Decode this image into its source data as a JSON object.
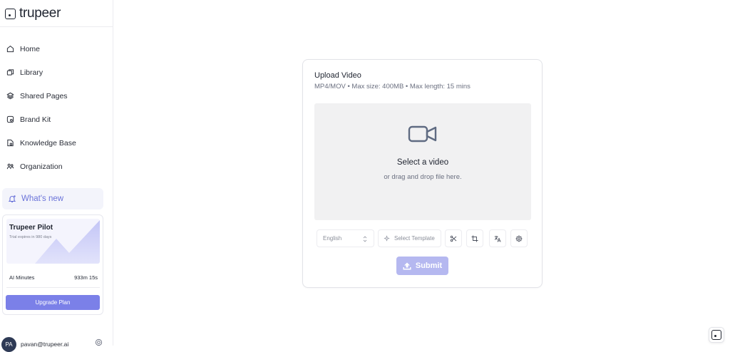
{
  "brand": {
    "name": "trupeer"
  },
  "sidebar": {
    "items": [
      {
        "label": "Home",
        "icon": "home-icon"
      },
      {
        "label": "Library",
        "icon": "library-icon"
      },
      {
        "label": "Shared Pages",
        "icon": "layers-icon"
      },
      {
        "label": "Brand Kit",
        "icon": "brand-kit-icon"
      },
      {
        "label": "Knowledge Base",
        "icon": "knowledge-base-icon"
      },
      {
        "label": "Organization",
        "icon": "organization-icon"
      }
    ],
    "whats_new": "What's new",
    "plan": {
      "title": "Trupeer Pilot",
      "subtitle": "Trial expires in 980 days",
      "minutes_label": "AI Minutes",
      "minutes_value": "933m 15s",
      "upgrade_label": "Upgrade Plan"
    },
    "profile": {
      "initials": "PA",
      "email": "pavan@trupeer.ai"
    }
  },
  "upload": {
    "title": "Upload Video",
    "subtitle": "MP4/MOV • Max size: 400MB • Max length: 15 mins",
    "drop_title": "Select a video",
    "drop_subtitle": "or drag and drop file here.",
    "language": "English",
    "template": "Select Template",
    "submit": "Submit"
  },
  "colors": {
    "accent": "#7b80e8",
    "submit_disabled": "#b5b8f0",
    "whats_new": "#6b74d9"
  }
}
